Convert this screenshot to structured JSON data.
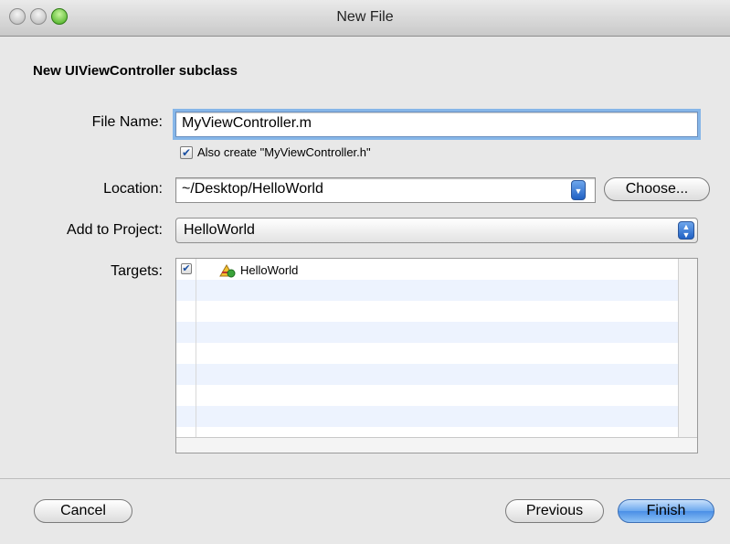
{
  "window": {
    "title": "New File"
  },
  "heading": "New UIViewController subclass",
  "file_name": {
    "label": "File Name:",
    "value": "MyViewController.m"
  },
  "also_create": {
    "checked": true,
    "label": "Also create \"MyViewController.h\""
  },
  "location": {
    "label": "Location:",
    "value": "~/Desktop/HelloWorld",
    "choose_label": "Choose..."
  },
  "add_to_project": {
    "label": "Add to Project:",
    "value": "HelloWorld"
  },
  "targets": {
    "label": "Targets:",
    "items": [
      {
        "name": "HelloWorld",
        "checked": true,
        "icon": "app-target-icon"
      }
    ]
  },
  "buttons": {
    "cancel": "Cancel",
    "previous": "Previous",
    "finish": "Finish"
  },
  "colors": {
    "accent": "#4a8fe6",
    "stripe": "#edf3fe"
  }
}
